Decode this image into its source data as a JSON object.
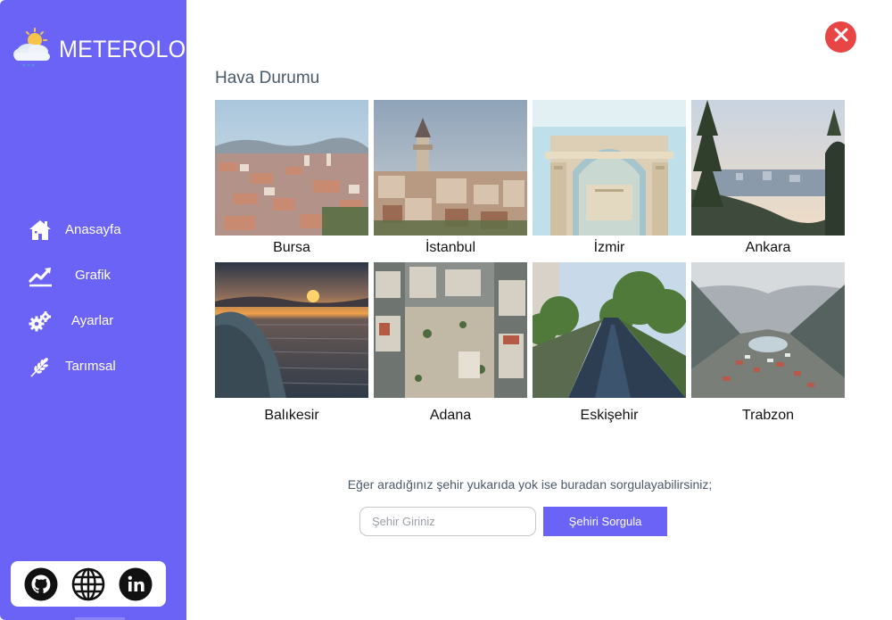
{
  "app": {
    "title": "METEROLOG",
    "logo_icon": "weather-cloud-sun-icon"
  },
  "sidebar": {
    "items": [
      {
        "label": "Anasayfa",
        "icon": "home-icon"
      },
      {
        "label": "Grafik",
        "icon": "chart-line-icon"
      },
      {
        "label": "Ayarlar",
        "icon": "gears-icon"
      },
      {
        "label": "Tarımsal",
        "icon": "wheat-icon"
      }
    ],
    "social": [
      {
        "name": "github",
        "icon": "github-icon"
      },
      {
        "name": "website",
        "icon": "globe-icon"
      },
      {
        "name": "linkedin",
        "icon": "linkedin-icon"
      }
    ]
  },
  "main": {
    "title": "Hava Durumu",
    "cities": [
      {
        "name": "Bursa"
      },
      {
        "name": "İstanbul"
      },
      {
        "name": "İzmir"
      },
      {
        "name": "Ankara"
      },
      {
        "name": "Balıkesir"
      },
      {
        "name": "Adana"
      },
      {
        "name": "Eskişehir"
      },
      {
        "name": "Trabzon"
      }
    ],
    "query_text": "Eğer aradığınız şehir yukarıda yok ise buradan sorgulayabilirsiniz;",
    "input_placeholder": "Şehir Giriniz",
    "input_value": "",
    "button_label": "Şehiri Sorgula"
  },
  "colors": {
    "sidebar": "#6a63f6",
    "close": "#e84545",
    "button": "#6a63f6"
  }
}
